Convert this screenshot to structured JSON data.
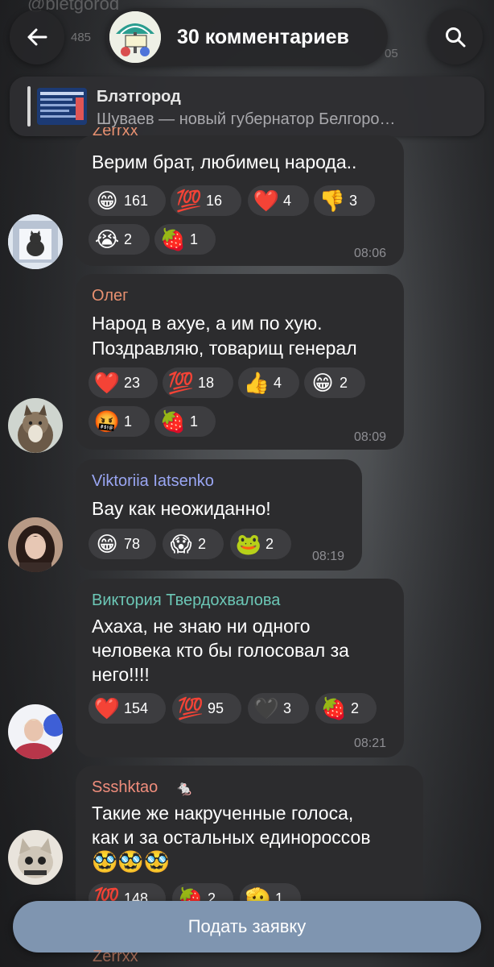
{
  "header": {
    "channel_bg": "@bletgorod",
    "bg_count": "485",
    "bg_time": "05",
    "title": "30 комментариев",
    "back_icon": "arrow-left-icon",
    "search_icon": "search-icon"
  },
  "pinned": {
    "title": "Блэтгород",
    "subtitle": "Шуваев — новый губернатор Белгоро…"
  },
  "top_cut_author": "Zerrxx",
  "messages": [
    {
      "author": "",
      "author_color": "#e79070",
      "lines": [
        "Верим брат, любимец народа.."
      ],
      "reactions": [
        {
          "emoji": "😁",
          "count": "161"
        },
        {
          "emoji": "💯",
          "count": "16"
        },
        {
          "emoji": "❤️",
          "count": "4"
        },
        {
          "emoji": "👎",
          "count": "3"
        },
        {
          "emoji": "😭",
          "count": "2"
        },
        {
          "emoji": "🍓",
          "count": "1"
        }
      ],
      "time": "08:06"
    },
    {
      "author": "Олег",
      "author_color": "#e79070",
      "lines": [
        "Народ в ахуе, а им по хую.",
        "Поздравляю, товарищ генерал"
      ],
      "reactions": [
        {
          "emoji": "❤️",
          "count": "23"
        },
        {
          "emoji": "💯",
          "count": "18"
        },
        {
          "emoji": "👍",
          "count": "4"
        },
        {
          "emoji": "😁",
          "count": "2"
        },
        {
          "emoji": "🤬",
          "count": "1"
        },
        {
          "emoji": "🍓",
          "count": "1"
        }
      ],
      "time": "08:09"
    },
    {
      "author": "Viktoriia Iatsenko",
      "author_color": "#9aa6f3",
      "lines": [
        "Вау как неожиданно!"
      ],
      "reactions": [
        {
          "emoji": "😁",
          "count": "78"
        },
        {
          "emoji": "😱",
          "count": "2"
        },
        {
          "emoji": "🐸",
          "count": "2"
        }
      ],
      "time": "08:19"
    },
    {
      "author": "Виктория Твердохвалова",
      "author_color": "#6cc7b6",
      "lines": [
        "Ахаха, не знаю ни одного",
        "человека кто бы голосовал за",
        "него!!!!"
      ],
      "reactions": [
        {
          "emoji": "❤️",
          "count": "154"
        },
        {
          "emoji": "💯",
          "count": "95"
        },
        {
          "emoji": "🖤",
          "count": "3"
        },
        {
          "emoji": "🍓",
          "count": "2"
        }
      ],
      "time": "08:21"
    },
    {
      "author": "Ssshktao",
      "author_color": "#f08d7c",
      "lines": [
        "Такие же накрученные голоса,",
        "как и за остальных единороссов",
        "🥸🥸🥸"
      ],
      "reactions": [
        {
          "emoji": "💯",
          "count": "148"
        },
        {
          "emoji": "🍓",
          "count": "2"
        },
        {
          "emoji": "🫡",
          "count": "1"
        }
      ],
      "time": ""
    }
  ],
  "join_button": "Подать заявку",
  "bottom_cut_author": "Zerrxx"
}
